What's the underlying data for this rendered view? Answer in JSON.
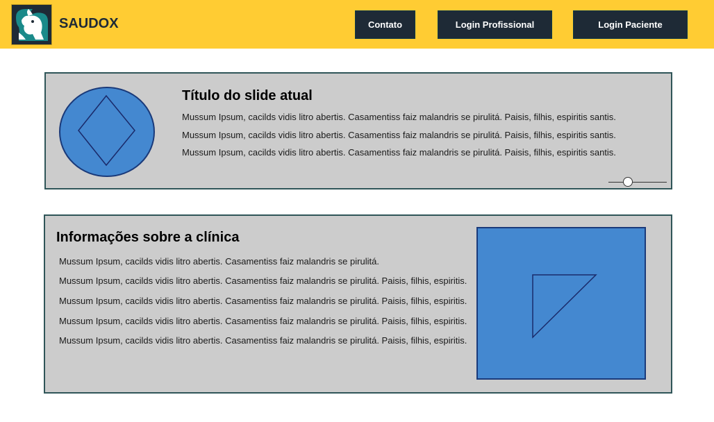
{
  "header": {
    "brand": "SAUDOX",
    "logo_icon": "bull-logo-icon",
    "buttons": [
      "Contato",
      "Login Profissional",
      "Login Paciente"
    ]
  },
  "slide": {
    "title": "Título do slide atual",
    "lines": [
      "Mussum Ipsum, cacilds vidis litro abertis. Casamentiss faiz malandris se pirulitá. Paisis, filhis, espiritis santis.",
      "Mussum Ipsum, cacilds vidis litro abertis. Casamentiss faiz malandris se pirulitá. Paisis, filhis, espiritis santis.",
      "Mussum Ipsum, cacilds vidis litro abertis. Casamentiss faiz malandris se pirulitá. Paisis, filhis, espiritis santis."
    ],
    "image_icon": "diamond-placeholder-icon",
    "slider_position": 0.33
  },
  "info": {
    "title": "Informações sobre a clínica",
    "lines": [
      "Mussum Ipsum, cacilds vidis litro abertis. Casamentiss faiz malandris se pirulitá.",
      "Mussum Ipsum, cacilds vidis litro abertis. Casamentiss faiz malandris se pirulitá. Paisis, filhis, espiritis.",
      "Mussum Ipsum, cacilds vidis litro abertis. Casamentiss faiz malandris se pirulitá. Paisis, filhis, espiritis.",
      "Mussum Ipsum, cacilds vidis litro abertis. Casamentiss faiz malandris se pirulitá. Paisis, filhis, espiritis.",
      "Mussum Ipsum, cacilds vidis litro abertis. Casamentiss faiz malandris se pirulitá. Paisis, filhis, espiritis."
    ],
    "image_icon": "triangle-placeholder-icon"
  },
  "colors": {
    "header_bg": "#ffcc33",
    "button_bg": "#1e2a36",
    "panel_bg": "#cccccc",
    "placeholder_blue": "#4488d0"
  }
}
